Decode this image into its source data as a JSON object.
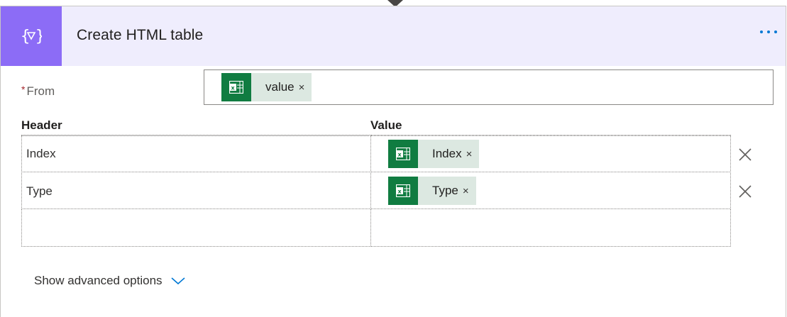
{
  "action": {
    "title": "Create HTML table",
    "icon": "data-operation-filter-icon",
    "accent_color": "#8c6cf6",
    "header_bg": "#efedfd"
  },
  "from": {
    "label": "From",
    "required_marker": "*",
    "token": {
      "label": "value",
      "remove": "×",
      "icon": "excel-icon"
    }
  },
  "table": {
    "header_label": "Header",
    "value_label": "Value",
    "rows": [
      {
        "header": "Index",
        "value": {
          "label": "Index",
          "remove": "×",
          "icon": "excel-icon"
        }
      },
      {
        "header": "Type",
        "value": {
          "label": "Type",
          "remove": "×",
          "icon": "excel-icon"
        }
      },
      {
        "header": "",
        "value": null
      }
    ]
  },
  "advanced": {
    "label": "Show advanced options"
  },
  "colors": {
    "excel_green": "#107c41",
    "token_bg": "#dce8e1",
    "link_blue": "#0078d4"
  }
}
